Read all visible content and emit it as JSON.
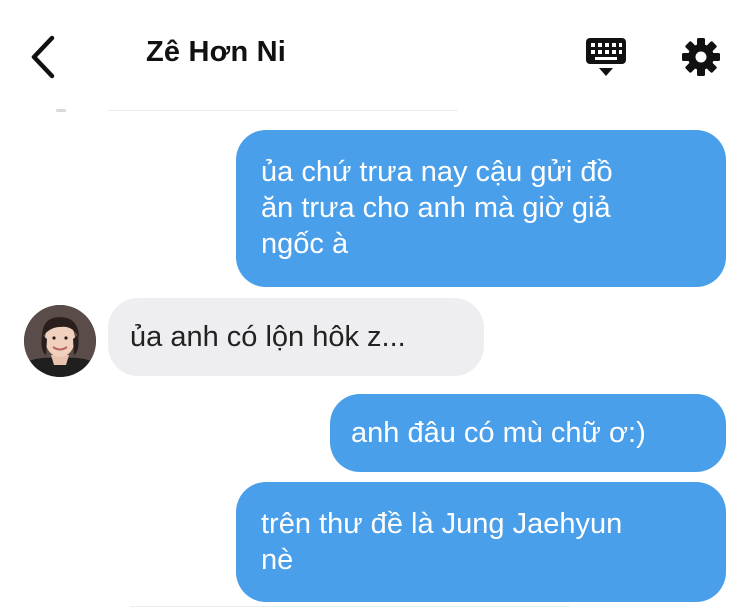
{
  "header": {
    "title": "Zê Hơn Ni",
    "back_icon": "chevron-left-icon",
    "keyboard_icon": "keyboard-icon",
    "settings_icon": "gear-icon"
  },
  "messages": [
    {
      "direction": "outgoing",
      "text": "ủa chứ trưa nay cậu gửi đồ\năn trưa cho anh mà giờ giả\nngốc à"
    },
    {
      "direction": "incoming",
      "text": "ủa anh có lộn hôk z..."
    },
    {
      "direction": "outgoing",
      "text": "anh đâu có mù chữ ơ:)"
    },
    {
      "direction": "outgoing",
      "text": "trên thư đề là Jung Jaehyun\nnè"
    }
  ],
  "colors": {
    "outgoing_bubble": "#4a9fea",
    "incoming_bubble": "#eeeef0",
    "header_text": "#111111"
  }
}
